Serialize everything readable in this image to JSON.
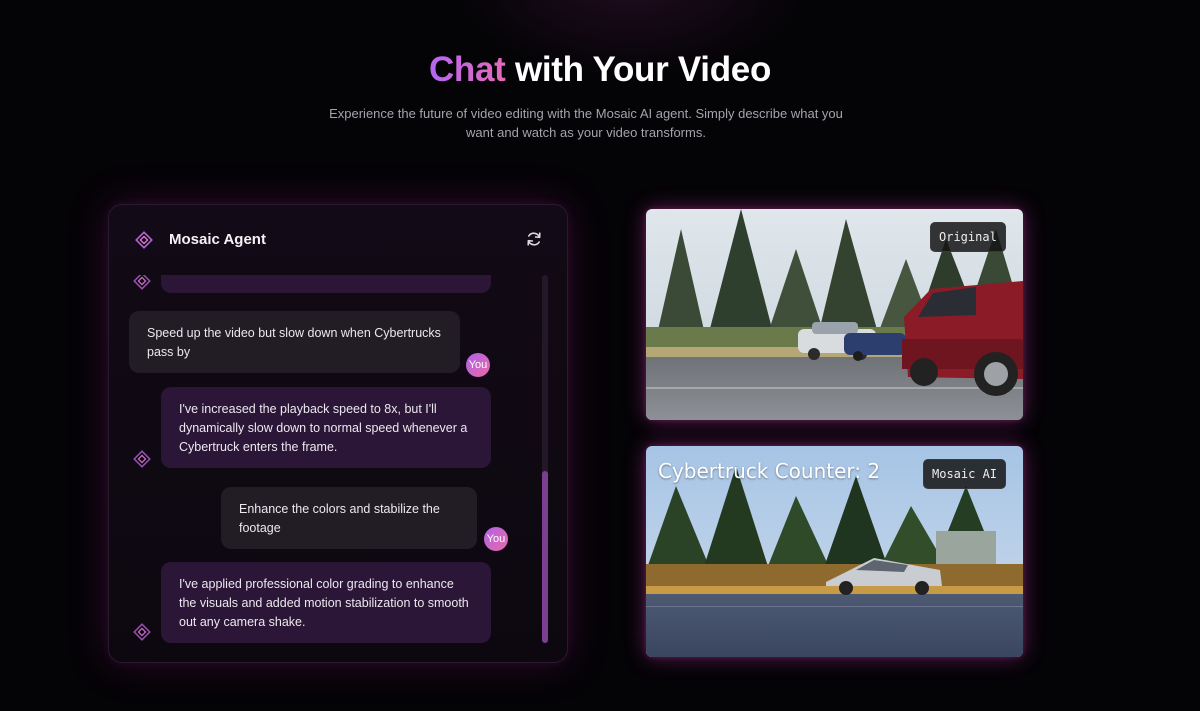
{
  "hero": {
    "title_accent": "Chat",
    "title_rest": " with Your Video",
    "subtitle": "Experience the future of video editing with the Mosaic AI agent. Simply describe what you want and watch as your video transforms."
  },
  "chat": {
    "agent_name": "Mosaic Agent",
    "icons": {
      "agent": "diamond-icon",
      "refresh": "refresh-icon"
    },
    "messages": [
      {
        "role": "agent",
        "text": ""
      },
      {
        "role": "user",
        "text": "Speed up the video but slow down when Cybertrucks pass by",
        "avatar": "You"
      },
      {
        "role": "agent",
        "text": "I've increased the playback speed to 8x, but I'll dynamically slow down to normal speed whenever a Cybertruck enters the frame."
      },
      {
        "role": "user",
        "text": "Enhance the colors and stabilize the footage",
        "avatar": "You"
      },
      {
        "role": "agent",
        "text": "I've applied professional color grading to enhance the visuals and added motion stabilization to smooth out any camera shake."
      }
    ]
  },
  "videos": {
    "original": {
      "badge": "Original"
    },
    "mosaic": {
      "badge": "Mosaic AI",
      "overlay": "Cybertruck Counter: 2"
    }
  },
  "colors": {
    "accent_purple": "#b666f2",
    "accent_pink": "#e36bb8",
    "agent_bubble": "#2b1637",
    "user_bubble": "#221c25",
    "background": "#040306"
  }
}
